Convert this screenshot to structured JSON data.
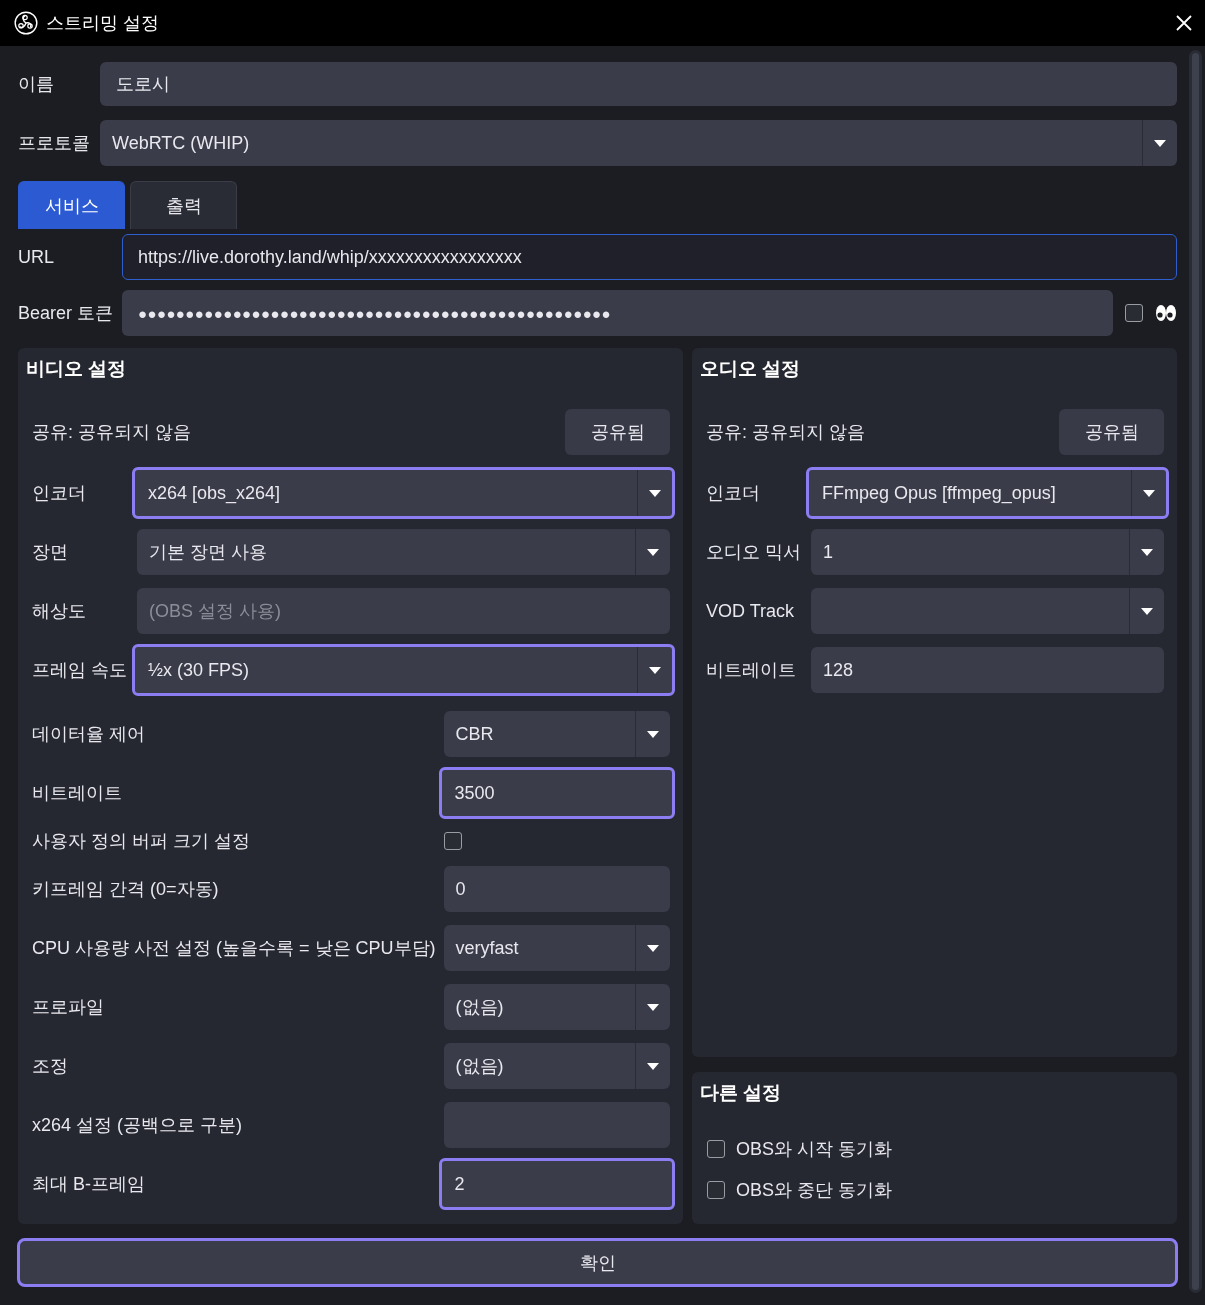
{
  "window": {
    "title": "스트리밍 설정"
  },
  "name": {
    "label": "이름",
    "value": "도로시"
  },
  "protocol": {
    "label": "프로토콜",
    "value": "WebRTC (WHIP)"
  },
  "tabs": [
    {
      "label": "서비스",
      "selected": true
    },
    {
      "label": "출력",
      "selected": false
    }
  ],
  "url": {
    "label": "URL",
    "value": "https://live.dorothy.land/whip/xxxxxxxxxxxxxxxxx",
    "focused": true
  },
  "bearer_token": {
    "label": "Bearer 토큰",
    "value": "●●●●●●●●●●●●●●●●●●●●●●●●●●●●●●●●●●●●●●●●●●●●●●●●●●",
    "show_checked": false
  },
  "video_settings": {
    "title": "비디오 설정",
    "share_status": "공유: 공유되지 않음",
    "share_button": "공유됨",
    "fields": [
      {
        "kind": "select",
        "label": "인코더",
        "value": "x264 [obs_x264]",
        "highlighted": true
      },
      {
        "kind": "select",
        "label": "장면",
        "value": "기본 장면 사용",
        "highlighted": false
      },
      {
        "kind": "input",
        "label": "해상도",
        "placeholder": "(OBS 설정 사용)",
        "highlighted": false
      },
      {
        "kind": "select",
        "label": "프레임 속도",
        "value": "½x (30 FPS)",
        "highlighted": true
      }
    ],
    "encoder_fields": [
      {
        "kind": "select",
        "label": "데이터율 제어",
        "value": "CBR",
        "highlighted": false
      },
      {
        "kind": "input",
        "label": "비트레이트",
        "value": "3500",
        "highlighted": true
      },
      {
        "kind": "checkbox",
        "label": "사용자 정의 버퍼 크기 설정",
        "checked": false,
        "highlighted": false
      },
      {
        "kind": "input",
        "label": "키프레임 간격 (0=자동)",
        "value": "0",
        "highlighted": false
      },
      {
        "kind": "select",
        "label": "CPU 사용량 사전 설정 (높을수록 = 낮은 CPU부담)",
        "value": "veryfast",
        "highlighted": false
      },
      {
        "kind": "select",
        "label": "프로파일",
        "value": "(없음)",
        "highlighted": false
      },
      {
        "kind": "select",
        "label": "조정",
        "value": "(없음)",
        "highlighted": false
      },
      {
        "kind": "input",
        "label": "x264 설정 (공백으로 구분)",
        "highlighted": false
      },
      {
        "kind": "input",
        "label": "최대 B-프레임",
        "value": "2",
        "highlighted": true
      }
    ]
  },
  "audio_settings": {
    "title": "오디오 설정",
    "share_status": "공유: 공유되지 않음",
    "share_button": "공유됨",
    "fields": [
      {
        "kind": "select",
        "label": "인코더",
        "value": "FFmpeg Opus [ffmpeg_opus]",
        "highlighted": true
      },
      {
        "kind": "select",
        "label": "오디오 믹서",
        "value": "1",
        "highlighted": false
      },
      {
        "kind": "select",
        "label": "VOD Track",
        "highlighted": false
      },
      {
        "kind": "input",
        "label": "비트레이트",
        "value": "128",
        "highlighted": false
      }
    ]
  },
  "other_settings": {
    "title": "다른 설정",
    "options": [
      {
        "label": "OBS와 시작 동기화",
        "checked": false
      },
      {
        "label": "OBS와 중단 동기화",
        "checked": false
      }
    ]
  },
  "ok_button": {
    "label": "확인"
  }
}
